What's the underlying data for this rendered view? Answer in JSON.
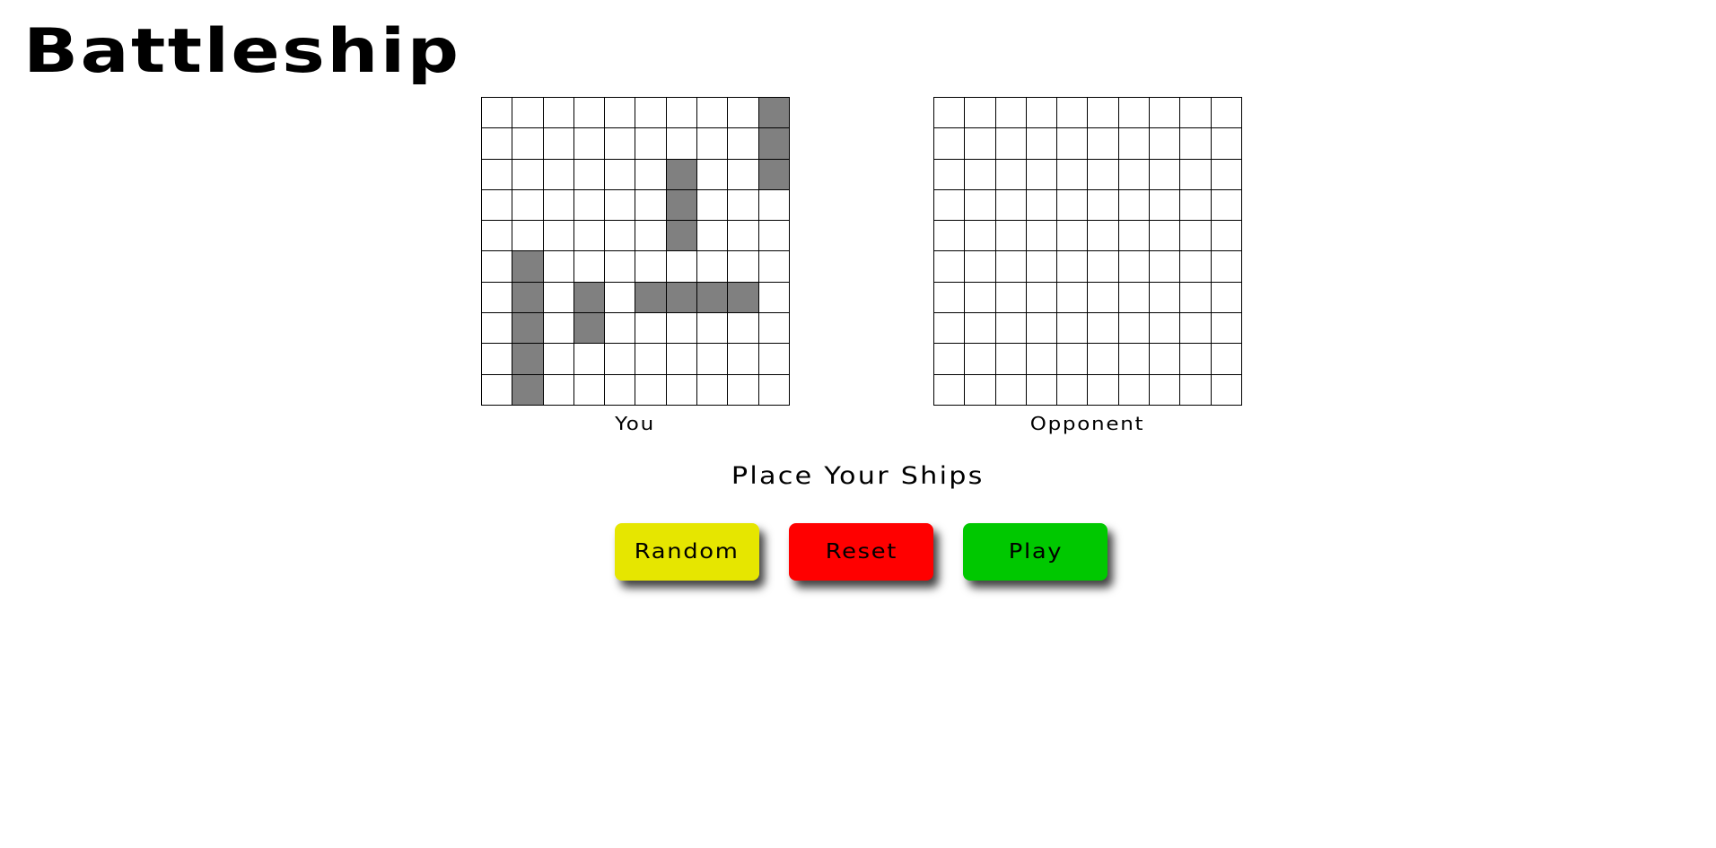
{
  "app": {
    "title": "Battleship"
  },
  "boards": {
    "you": {
      "label": "You",
      "rows": 10,
      "cols": 10,
      "ship_cells": [
        [
          0,
          9
        ],
        [
          1,
          9
        ],
        [
          2,
          9
        ],
        [
          2,
          6
        ],
        [
          3,
          6
        ],
        [
          4,
          6
        ],
        [
          5,
          1
        ],
        [
          6,
          1
        ],
        [
          7,
          1
        ],
        [
          8,
          1
        ],
        [
          9,
          1
        ],
        [
          6,
          3
        ],
        [
          7,
          3
        ],
        [
          6,
          5
        ],
        [
          6,
          6
        ],
        [
          6,
          7
        ],
        [
          6,
          8
        ]
      ]
    },
    "opponent": {
      "label": "Opponent",
      "rows": 10,
      "cols": 10,
      "ship_cells": []
    }
  },
  "status": {
    "text": "Place Your Ships"
  },
  "buttons": {
    "random": {
      "label": "Random",
      "color": "#e6e600"
    },
    "reset": {
      "label": "Reset",
      "color": "#ff0000"
    },
    "play": {
      "label": "Play",
      "color": "#00c800"
    }
  },
  "colors": {
    "ship": "#808080",
    "water": "#ffffff",
    "grid_line": "#000000"
  }
}
